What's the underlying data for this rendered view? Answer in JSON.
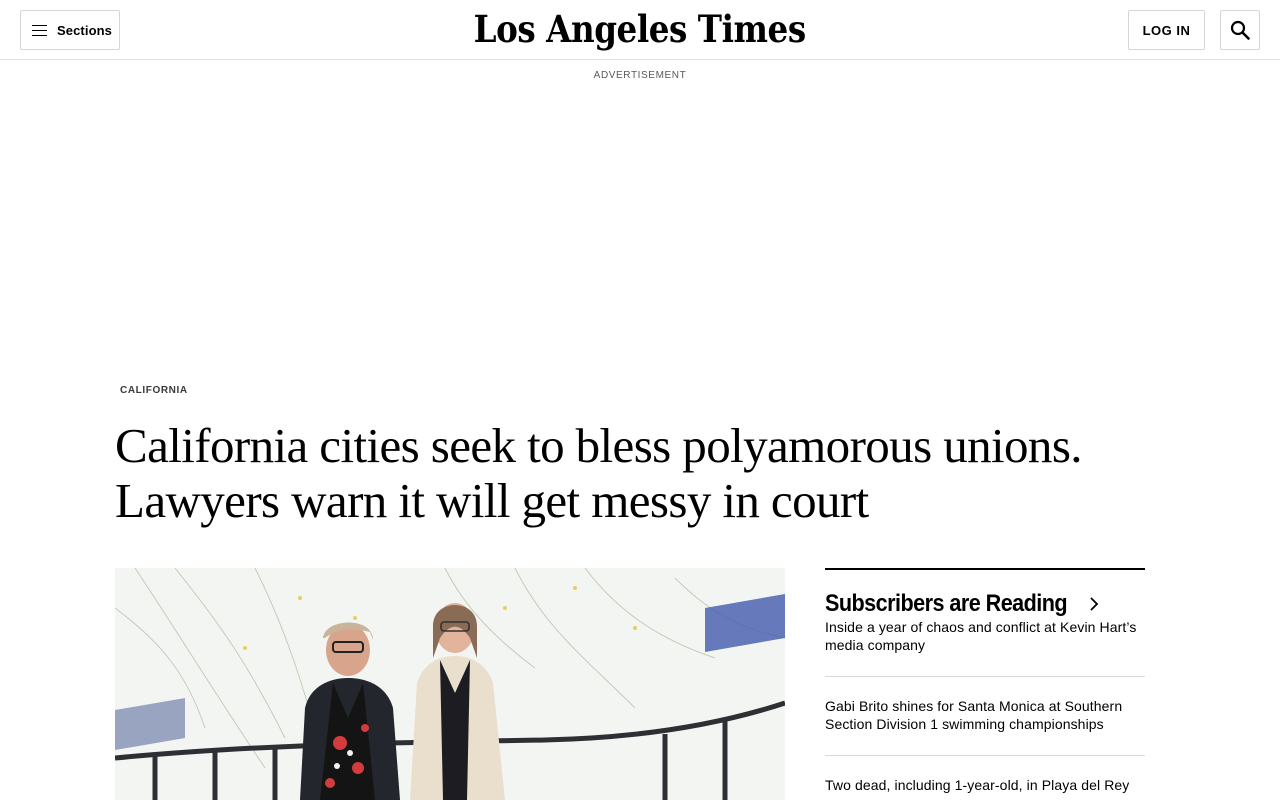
{
  "header": {
    "sections_label": "Sections",
    "logo_text": "Los Angeles Times",
    "login_label": "LOG IN"
  },
  "ad": {
    "label": "ADVERTISEMENT"
  },
  "article": {
    "section": "CALIFORNIA",
    "headline_line1": "California cities seek to bless polyamorous unions.",
    "headline_line2": "Lawyers warn it will get messy in court"
  },
  "sidebar": {
    "title": "Subscribers are Reading",
    "stories": [
      {
        "text": "Inside a year of chaos and conflict at Kevin Hart’s media company"
      },
      {
        "text": "Gabi Brito shines for Santa Monica at Southern Section Division 1 swimming championships"
      },
      {
        "text": "Two dead, including 1-year-old, in Playa del Rey"
      }
    ]
  },
  "icons": {
    "menu": "hamburger-icon",
    "search": "search-icon",
    "chevron": "chevron-right-icon"
  }
}
